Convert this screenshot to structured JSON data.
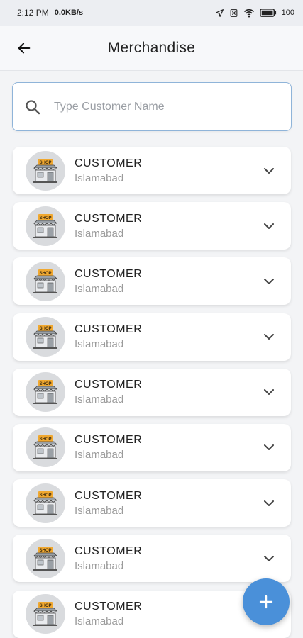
{
  "status_bar": {
    "time": "2:12 PM",
    "speed": "0.0KB/s",
    "battery": "100"
  },
  "header": {
    "title": "Merchandise",
    "back_icon": "arrow-left-icon"
  },
  "search": {
    "placeholder": "Type Customer Name",
    "value": "",
    "icon": "search-icon"
  },
  "customers": [
    {
      "name": "CUSTOMER",
      "city": "Islamabad",
      "shop_label": "SHOP"
    },
    {
      "name": "CUSTOMER",
      "city": "Islamabad",
      "shop_label": "SHOP"
    },
    {
      "name": "CUSTOMER",
      "city": "Islamabad",
      "shop_label": "SHOP"
    },
    {
      "name": "CUSTOMER",
      "city": "Islamabad",
      "shop_label": "SHOP"
    },
    {
      "name": "CUSTOMER",
      "city": "Islamabad",
      "shop_label": "SHOP"
    },
    {
      "name": "CUSTOMER",
      "city": "Islamabad",
      "shop_label": "SHOP"
    },
    {
      "name": "CUSTOMER",
      "city": "Islamabad",
      "shop_label": "SHOP"
    },
    {
      "name": "CUSTOMER",
      "city": "Islamabad",
      "shop_label": "SHOP"
    },
    {
      "name": "CUSTOMER",
      "city": "Islamabad",
      "shop_label": "SHOP"
    }
  ],
  "fab": {
    "icon": "plus-icon",
    "color": "#4a90d9"
  },
  "colors": {
    "accent": "#4a90d9",
    "shop_sign": "#f0a830",
    "background": "#f3f4f6"
  }
}
